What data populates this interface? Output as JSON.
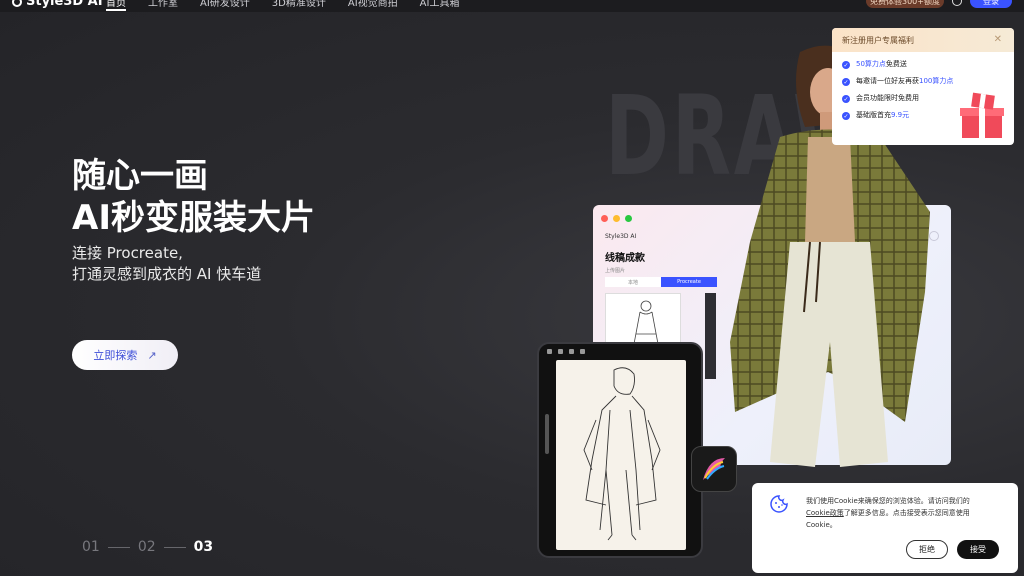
{
  "nav": {
    "logo": "Style3D AI",
    "items": [
      "首页",
      "工作室",
      "AI研发设计",
      "3D精准设计",
      "AI视觉商拍",
      "AI工具箱"
    ],
    "active_index": 0,
    "promo": "免费体验300+额度",
    "login": "登录"
  },
  "hero": {
    "title_line1": "随心一画",
    "title_line2": "AI秒变服装大片",
    "sub_line1": "连接 Procreate,",
    "sub_line2": "打通灵感到成衣的 AI 快车道",
    "explore_label": "立即探索",
    "pager": [
      "01",
      "02",
      "03"
    ],
    "pager_active": 2
  },
  "bg_text": "DRAW",
  "mock_window": {
    "logo": "Style3D AI",
    "title": "线稿成款",
    "subtitle": "上传图片",
    "tab1": "本地",
    "tab2": "Procreate"
  },
  "promo": {
    "title": "新注册用户专属福利",
    "items": [
      {
        "pre": "",
        "hl": "50算力点",
        "post": "免费送"
      },
      {
        "pre": "每邀请一位好友再获",
        "hl": "100算力点",
        "post": ""
      },
      {
        "pre": "会员功能限时免费用",
        "hl": "",
        "post": ""
      },
      {
        "pre": "基础版首充",
        "hl": "9.9元",
        "post": ""
      }
    ]
  },
  "cookie": {
    "text_before": "我们使用Cookie来确保您的浏览体验。请访问我们的",
    "link": "Cookie政策",
    "text_after": "了解更多信息。点击接受表示您同意使用Cookie。",
    "reject": "拒绝",
    "accept": "接受"
  },
  "colors": {
    "accent": "#3a53ff",
    "background": "#2a2a2e"
  }
}
